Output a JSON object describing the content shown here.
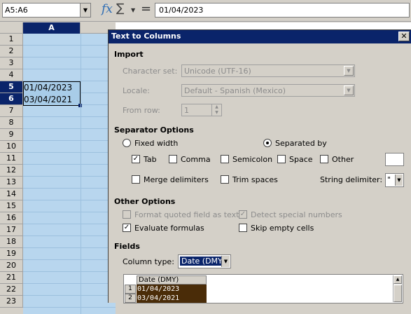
{
  "formula_bar": {
    "name_box": "A5:A6",
    "formula": "01/04/2023",
    "fx_icon": "function-wizard-icon",
    "sum_icon": "sum-icon",
    "equals_icon": "formula-icon"
  },
  "sheet": {
    "col_header": "A",
    "rows": [
      "1",
      "2",
      "3",
      "4",
      "5",
      "6",
      "7",
      "8",
      "9",
      "10",
      "11",
      "12",
      "13",
      "14",
      "15",
      "16",
      "17",
      "18",
      "19",
      "20",
      "21",
      "22",
      "23"
    ],
    "cells": {
      "a5": "01/04/2023",
      "a6": "03/04/2021"
    }
  },
  "dialog": {
    "title": "Text to Columns",
    "close": "✕",
    "import": {
      "heading": "Import",
      "charset_label_pre": "",
      "charset_label": "Character set:",
      "charset_value": "Unicode (UTF-16)",
      "locale_label": "Locale:",
      "locale_value": "Default - Spanish (Mexico)",
      "fromrow_label": "From row:",
      "fromrow_value": "1"
    },
    "separator": {
      "heading": "Separator Options",
      "fixed_width": "Fixed width",
      "separated_by": "Separated by",
      "tab": "Tab",
      "comma": "Comma",
      "semicolon": "Semicolon",
      "space": "Space",
      "other": "Other",
      "merge": "Merge delimiters",
      "trim": "Trim spaces",
      "string_delim_label": "String delimiter:",
      "string_delim_value": "\"",
      "tab_checked": true,
      "separated_selected": true
    },
    "other_options": {
      "heading": "Other Options",
      "format_quoted": "Format quoted field as text",
      "detect_special": "Detect special numbers",
      "evaluate": "Evaluate formulas",
      "skip_empty": "Skip empty cells"
    },
    "fields": {
      "heading": "Fields",
      "column_type_label": "Column type:",
      "column_type_value": "Date (DMY)",
      "preview_header": "Date (DMY)",
      "preview_rows": [
        {
          "num": "1",
          "value": "01/04/2023"
        },
        {
          "num": "2",
          "value": "03/04/2021"
        }
      ]
    }
  }
}
